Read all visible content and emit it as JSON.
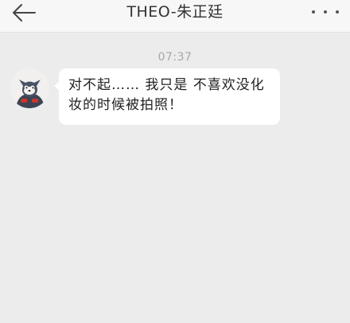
{
  "header": {
    "title": "THEO-朱正廷",
    "back_icon": "arrow-left-icon",
    "more_icon": "more-dots-icon"
  },
  "conversation": {
    "timestamp": "07:37",
    "messages": [
      {
        "sender_avatar": "cartoon-cat-avatar",
        "text": "对不起…… 我只是 不喜欢没化妆的时候被拍照！"
      }
    ]
  }
}
